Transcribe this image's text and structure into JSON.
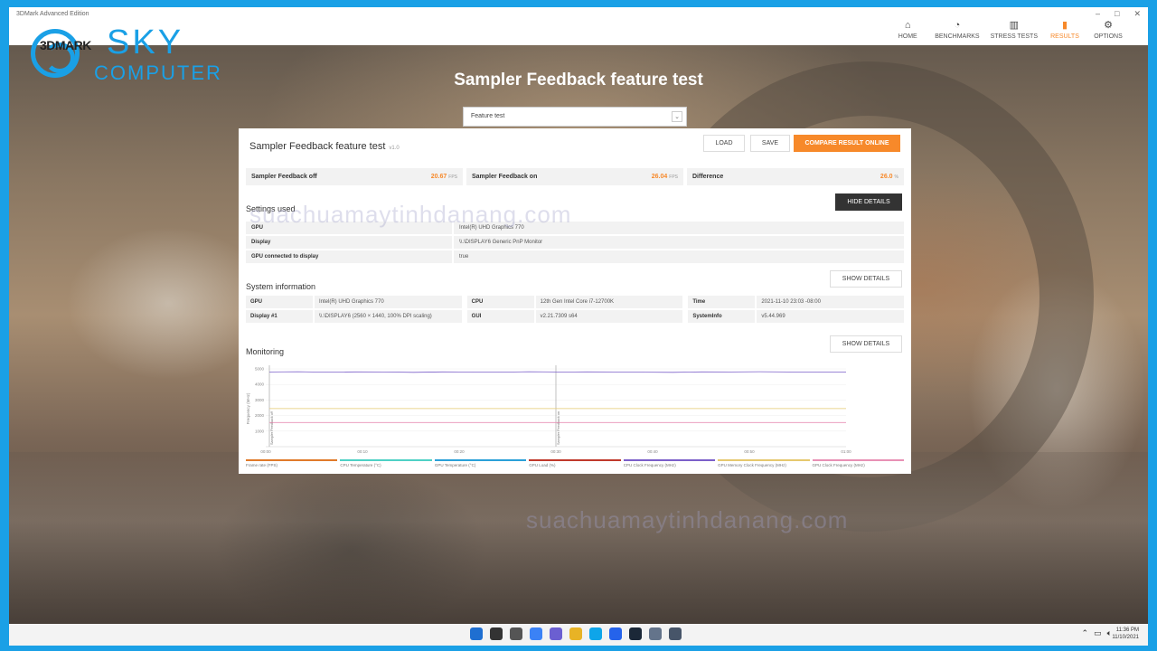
{
  "window": {
    "title": "3DMark Advanced Edition",
    "controls": [
      "–",
      "□",
      "✕"
    ]
  },
  "logo": {
    "mark": "3DMARK",
    "brand": "SKY",
    "sub": "COMPUTER"
  },
  "nav": [
    {
      "label": "HOME",
      "icon": "home-icon",
      "glyph": "⌂"
    },
    {
      "label": "BENCHMARKS",
      "icon": "gauge-icon",
      "glyph": "◔"
    },
    {
      "label": "STRESS TESTS",
      "icon": "bars-icon",
      "glyph": "▥"
    },
    {
      "label": "RESULTS",
      "icon": "results-icon",
      "glyph": "▮"
    },
    {
      "label": "OPTIONS",
      "icon": "gear-icon",
      "glyph": "⚙"
    }
  ],
  "page": {
    "title": "Sampler Feedback feature test"
  },
  "feature_select": {
    "value": "Feature test"
  },
  "panel": {
    "title": "Sampler Feedback feature test",
    "version": "v1.0",
    "buttons": {
      "load": "LOAD",
      "save": "SAVE",
      "compare": "COMPARE RESULT ONLINE"
    },
    "scores": [
      {
        "name": "Sampler Feedback off",
        "value": "20.67",
        "unit": "FPS"
      },
      {
        "name": "Sampler Feedback on",
        "value": "26.04",
        "unit": "FPS"
      },
      {
        "name": "Difference",
        "value": "26.0",
        "unit": "%"
      }
    ],
    "settings_title": "Settings used",
    "hide_details": "HIDE DETAILS",
    "settings": [
      {
        "key": "GPU",
        "value": "Intel(R) UHD Graphics 770"
      },
      {
        "key": "Display",
        "value": "\\\\.\\DISPLAY6 Generic PnP Monitor"
      },
      {
        "key": "GPU connected to display",
        "value": "true"
      }
    ],
    "sysinfo_title": "System information",
    "show_details": "SHOW DETAILS",
    "sysinfo": [
      {
        "key": "GPU",
        "value": "Intel(R) UHD Graphics 770"
      },
      {
        "key": "CPU",
        "value": "12th Gen Intel Core i7-12700K"
      },
      {
        "key": "Time",
        "value": "2021-11-10 23:03 -08:00"
      },
      {
        "key": "Display #1",
        "value": "\\\\.\\DISPLAY6 (2560 × 1440, 100% DPI scaling)"
      },
      {
        "key": "GUI",
        "value": "v2.21.7309 s64"
      },
      {
        "key": "SystemInfo",
        "value": "v5.44.969"
      }
    ],
    "monitoring_title": "Monitoring",
    "monitoring_show": "SHOW DETAILS"
  },
  "chart_data": {
    "type": "line",
    "ylabel": "Frequency (MHz)",
    "ylim": [
      0,
      5000
    ],
    "y_ticks": [
      "5000",
      "4000",
      "3000",
      "2000",
      "1000"
    ],
    "x_ticks": [
      "00:00",
      "00:10",
      "00:20",
      "00:30",
      "00:40",
      "00:50",
      "01:00"
    ],
    "markers": [
      {
        "x": 0.0,
        "label": "Sampler Feedback off"
      },
      {
        "x": 0.5,
        "label": "Sampler Feedback on"
      }
    ],
    "series": [
      {
        "name": "GPU Clock Frequency (MHz)",
        "color": "#7b5fc9",
        "values": [
          4800,
          4820,
          4790,
          4810,
          4800,
          4780,
          4810,
          4800,
          4790,
          4820,
          4800,
          4810,
          4800,
          4790,
          4780,
          4810,
          4800,
          4820,
          4800,
          4790,
          4800
        ]
      },
      {
        "name": "GPU Memory Clock Frequency (MHz)",
        "color": "#e6c86e",
        "values": [
          2450,
          2450,
          2450,
          2450,
          2450,
          2450,
          2450,
          2450,
          2450,
          2450,
          2450,
          2450,
          2450,
          2450,
          2450,
          2450,
          2450,
          2450,
          2450,
          2450,
          2450
        ]
      },
      {
        "name": "GPU Clock Frequency (MHz)",
        "color": "#e891b5",
        "values": [
          1550,
          1550,
          1550,
          1550,
          1550,
          1550,
          1550,
          1550,
          1550,
          1550,
          1550,
          1550,
          1550,
          1550,
          1550,
          1550,
          1550,
          1550,
          1550,
          1550,
          1550
        ]
      }
    ]
  },
  "legend": [
    {
      "label": "Frame rate (FPS)",
      "color": "#e07a2a"
    },
    {
      "label": "CPU Temperature (°C)",
      "color": "#4fd1c5"
    },
    {
      "label": "GPU Temperature (°C)",
      "color": "#2aa0d8"
    },
    {
      "label": "GPU Load (%)",
      "color": "#c0392b"
    },
    {
      "label": "CPU Clock Frequency (MHz)",
      "color": "#7b5fc9"
    },
    {
      "label": "GPU Memory Clock Frequency (MHz)",
      "color": "#e6c86e"
    },
    {
      "label": "GPU Clock Frequency (MHz)",
      "color": "#e891b5"
    }
  ],
  "watermark": "suachuamaytinhdanang.com",
  "taskbar": {
    "time": "11:36 PM",
    "date": "11/10/2021",
    "icons": [
      "start-icon",
      "search-icon",
      "task-view-icon",
      "widgets-icon",
      "chat-icon",
      "explorer-icon",
      "edge-icon",
      "store-icon",
      "steam-icon",
      "app-icon",
      "app2-icon"
    ]
  }
}
